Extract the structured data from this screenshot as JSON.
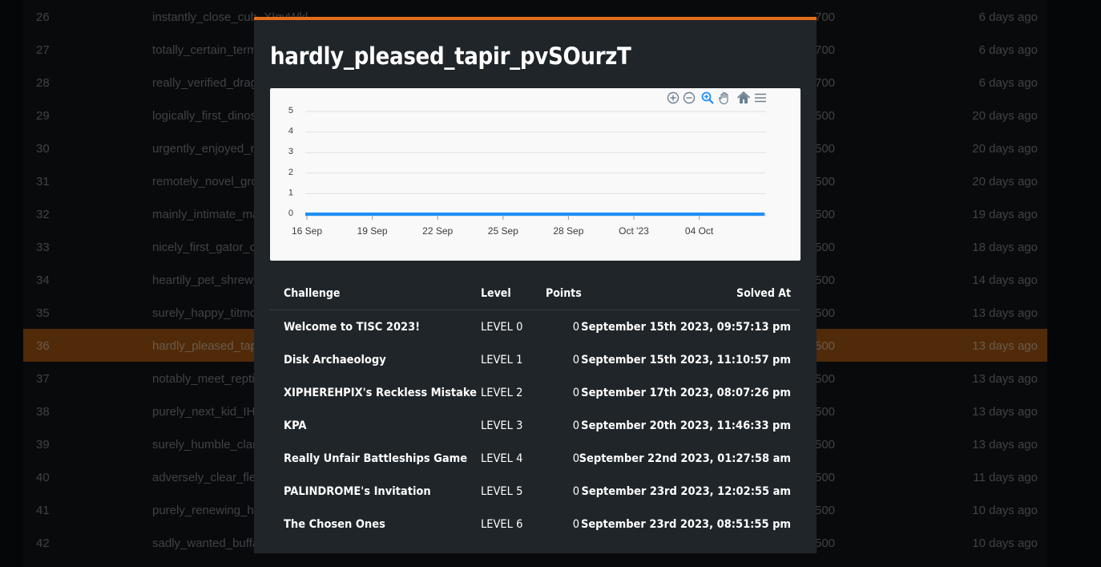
{
  "background": {
    "rows": [
      {
        "rank": "26",
        "name": "instantly_close_cub_XIgvWkl",
        "points": "700",
        "time": "6 days ago"
      },
      {
        "rank": "27",
        "name": "totally_certain_term",
        "points": "700",
        "time": "6 days ago"
      },
      {
        "rank": "28",
        "name": "really_verified_drag",
        "points": "700",
        "time": "6 days ago"
      },
      {
        "rank": "29",
        "name": "logically_first_dinos",
        "points": "500",
        "time": "20 days ago"
      },
      {
        "rank": "30",
        "name": "urgently_enjoyed_m",
        "points": "500",
        "time": "20 days ago"
      },
      {
        "rank": "31",
        "name": "remotely_novel_gro",
        "points": "500",
        "time": "20 days ago"
      },
      {
        "rank": "32",
        "name": "mainly_intimate_ma",
        "points": "500",
        "time": "19 days ago"
      },
      {
        "rank": "33",
        "name": "nicely_first_gator_c",
        "points": "500",
        "time": "18 days ago"
      },
      {
        "rank": "34",
        "name": "heartily_pet_shrew_",
        "points": "500",
        "time": "14 days ago"
      },
      {
        "rank": "35",
        "name": "surely_happy_titmo",
        "points": "500",
        "time": "13 days ago"
      },
      {
        "rank": "36",
        "name": "hardly_pleased_tap",
        "points": "500",
        "time": "13 days ago",
        "highlight": true
      },
      {
        "rank": "37",
        "name": "notably_meet_repti",
        "points": "500",
        "time": "13 days ago"
      },
      {
        "rank": "38",
        "name": "purely_next_kid_IHp",
        "points": "500",
        "time": "13 days ago"
      },
      {
        "rank": "39",
        "name": "surely_humble_clan",
        "points": "500",
        "time": "13 days ago"
      },
      {
        "rank": "40",
        "name": "adversely_clear_flea",
        "points": "500",
        "time": "11 days ago"
      },
      {
        "rank": "41",
        "name": "purely_renewing_ha",
        "points": "500",
        "time": "10 days ago"
      },
      {
        "rank": "42",
        "name": "sadly_wanted_buffa",
        "points": "500",
        "time": "10 days ago"
      }
    ]
  },
  "modal": {
    "title": "hardly_pleased_tapir_pvSOurzT",
    "accent_color": "#e56d19",
    "toolbar_icons": [
      "zoom-in-icon",
      "zoom-out-icon",
      "selection-zoom-icon",
      "pan-icon",
      "home-icon",
      "menu-icon"
    ]
  },
  "chart_data": {
    "type": "line",
    "x_tick_labels": [
      "16 Sep",
      "19 Sep",
      "22 Sep",
      "25 Sep",
      "28 Sep",
      "Oct '23",
      "04 Oct"
    ],
    "y_tick_labels": [
      "0",
      "1",
      "2",
      "3",
      "4",
      "5"
    ],
    "ylim": [
      0,
      5
    ],
    "grid": true,
    "series": [
      {
        "color": "#1f8ff5",
        "x": [
          "2023-09-15",
          "2023-09-16",
          "2023-09-19",
          "2023-09-22",
          "2023-09-25",
          "2023-09-28",
          "2023-10-01",
          "2023-10-04",
          "2023-10-07"
        ],
        "values": [
          0,
          0,
          0,
          0,
          0,
          0,
          0,
          0,
          0
        ]
      }
    ]
  },
  "table": {
    "headers": {
      "challenge": "Challenge",
      "level": "Level",
      "points": "Points",
      "solved_at": "Solved At"
    },
    "rows": [
      {
        "challenge": "Welcome to TISC 2023!",
        "level": "LEVEL 0",
        "points": "0",
        "solved_at": "September 15th 2023, 09:57:13 pm"
      },
      {
        "challenge": "Disk Archaeology",
        "level": "LEVEL 1",
        "points": "0",
        "solved_at": "September 15th 2023, 11:10:57 pm"
      },
      {
        "challenge": "XIPHEREHPIX's Reckless Mistake",
        "level": "LEVEL 2",
        "points": "0",
        "solved_at": "September 17th 2023, 08:07:26 pm"
      },
      {
        "challenge": "KPA",
        "level": "LEVEL 3",
        "points": "0",
        "solved_at": "September 20th 2023, 11:46:33 pm"
      },
      {
        "challenge": "Really Unfair Battleships Game",
        "level": "LEVEL 4",
        "points": "0",
        "solved_at": "September 22nd 2023, 01:27:58 am"
      },
      {
        "challenge": "PALINDROME's Invitation",
        "level": "LEVEL 5",
        "points": "0",
        "solved_at": "September 23rd 2023, 12:02:55 am"
      },
      {
        "challenge": "The Chosen Ones",
        "level": "LEVEL 6",
        "points": "0",
        "solved_at": "September 23rd 2023, 08:51:55 pm"
      }
    ]
  }
}
